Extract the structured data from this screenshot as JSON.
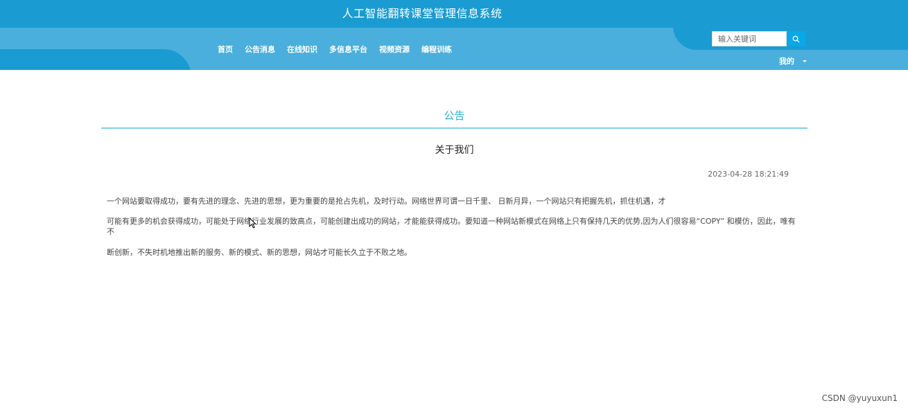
{
  "header": {
    "site_title": "人工智能翻转课堂管理信息系统",
    "nav": [
      {
        "label": "首页"
      },
      {
        "label": "公告消息"
      },
      {
        "label": "在线知识"
      },
      {
        "label": "多信息平台"
      },
      {
        "label": "视频资源"
      },
      {
        "label": "编程训练"
      }
    ],
    "search": {
      "placeholder": "输入关键词",
      "value": ""
    },
    "user_menu": "我的",
    "colors": {
      "header_dark": "#1a9bd2",
      "header_light": "#4aafdc",
      "search_button": "#0aa8e8"
    }
  },
  "main": {
    "section_title": "公告",
    "article": {
      "title": "关于我们",
      "time": "2023-04-28 18:21:49",
      "paragraphs": [
        "一个网站要取得成功，要有先进的理念、先进的思想，更为重要的是抢占先机，及时行动。网络世界可谓一日千里、 日新月异，一个网站只有把握先机，抓住机遇，才",
        "可能有更多的机会获得成功，可能处于网络行业发展的致高点，可能创建出成功的网站，才能能获得成功。要知道一种网站新模式在网络上只有保持几天的优势,因为人们很容易“COPY” 和模仿，因此，唯有不",
        "断创新，不失时机地推出新的服务、新的模式、新的思想，网站才可能长久立于不败之地。"
      ]
    },
    "accent_color": "#2ab3d2"
  },
  "watermark": "CSDN @yuyuxun1"
}
